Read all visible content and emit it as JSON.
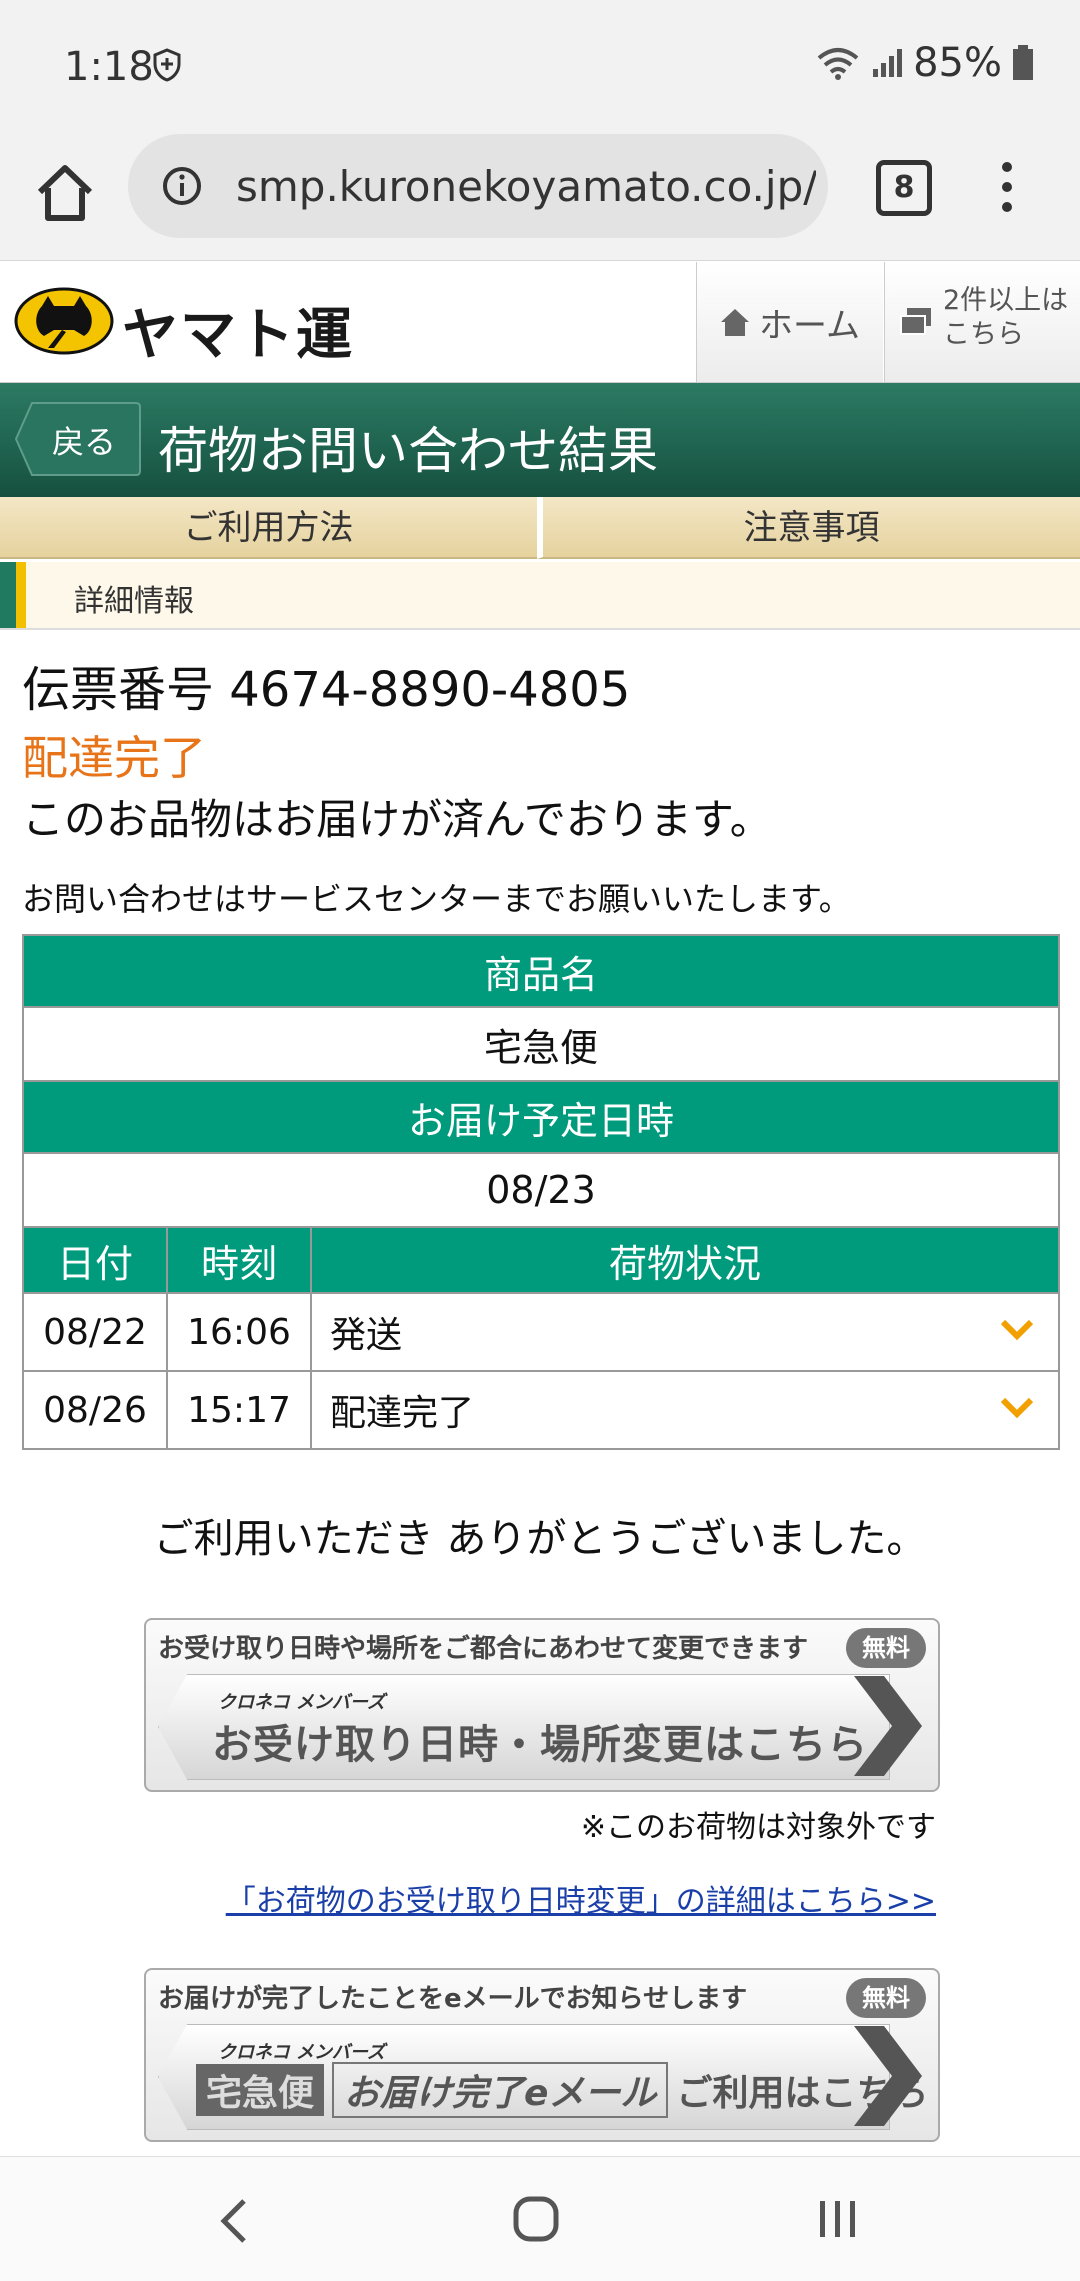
{
  "status_bar": {
    "time": "1:18",
    "battery": "85%"
  },
  "browser": {
    "url": "smp.kuronekoyamato.co.jp/",
    "tab_count": "8"
  },
  "site_header": {
    "logo_text": "ヤマト運輸",
    "home_label": "ホーム",
    "multi_label_line1": "2件以上は",
    "multi_label_line2": "こちら"
  },
  "title_bar": {
    "back_label": "戻る",
    "title": "荷物お問い合わせ結果"
  },
  "tabs": [
    {
      "label": "ご利用方法"
    },
    {
      "label": "注意事項"
    }
  ],
  "detail_strip": {
    "label": "詳細情報"
  },
  "result": {
    "slip_number": "伝票番号 4674-8890-4805",
    "status": "配達完了",
    "status_message": "このお品物はお届けが済んでおります。",
    "contact_message": "お問い合わせはサービスセンターまでお願いいたします。"
  },
  "info_table": {
    "product_header": "商品名",
    "product_value": "宅急便",
    "scheduled_header": "お届け予定日時",
    "scheduled_value": "08/23",
    "columns": [
      "日付",
      "時刻",
      "荷物状況"
    ],
    "rows": [
      {
        "date": "08/22",
        "time": "16:06",
        "status": "発送"
      },
      {
        "date": "08/26",
        "time": "15:17",
        "status": "配達完了"
      }
    ]
  },
  "thanks": "ご利用いただき ありがとうございました。",
  "banner1": {
    "top_text": "お受け取り日時や場所をご都合にあわせて変更できます",
    "free": "無料",
    "small": "クロネコ メンバーズ",
    "main": "お受け取り日時・場所変更はこちら"
  },
  "note": "※このお荷物は対象外です",
  "detail_link": "「お荷物のお受け取り日時変更」の詳細はこちら>>",
  "banner2": {
    "top_text": "お届けが完了したことをeメールでお知らせします",
    "free": "無料",
    "small": "クロネコ メンバーズ",
    "pill_a": "宅急便",
    "pill_b": "お届け完了eメール",
    "main": "ご利用はこちら"
  },
  "colors": {
    "header_green": "#1f6450",
    "table_green": "#009b7d",
    "status_orange": "#e8741a",
    "tab_beige": "#efdfb4",
    "link_blue": "#1a3fa8"
  }
}
